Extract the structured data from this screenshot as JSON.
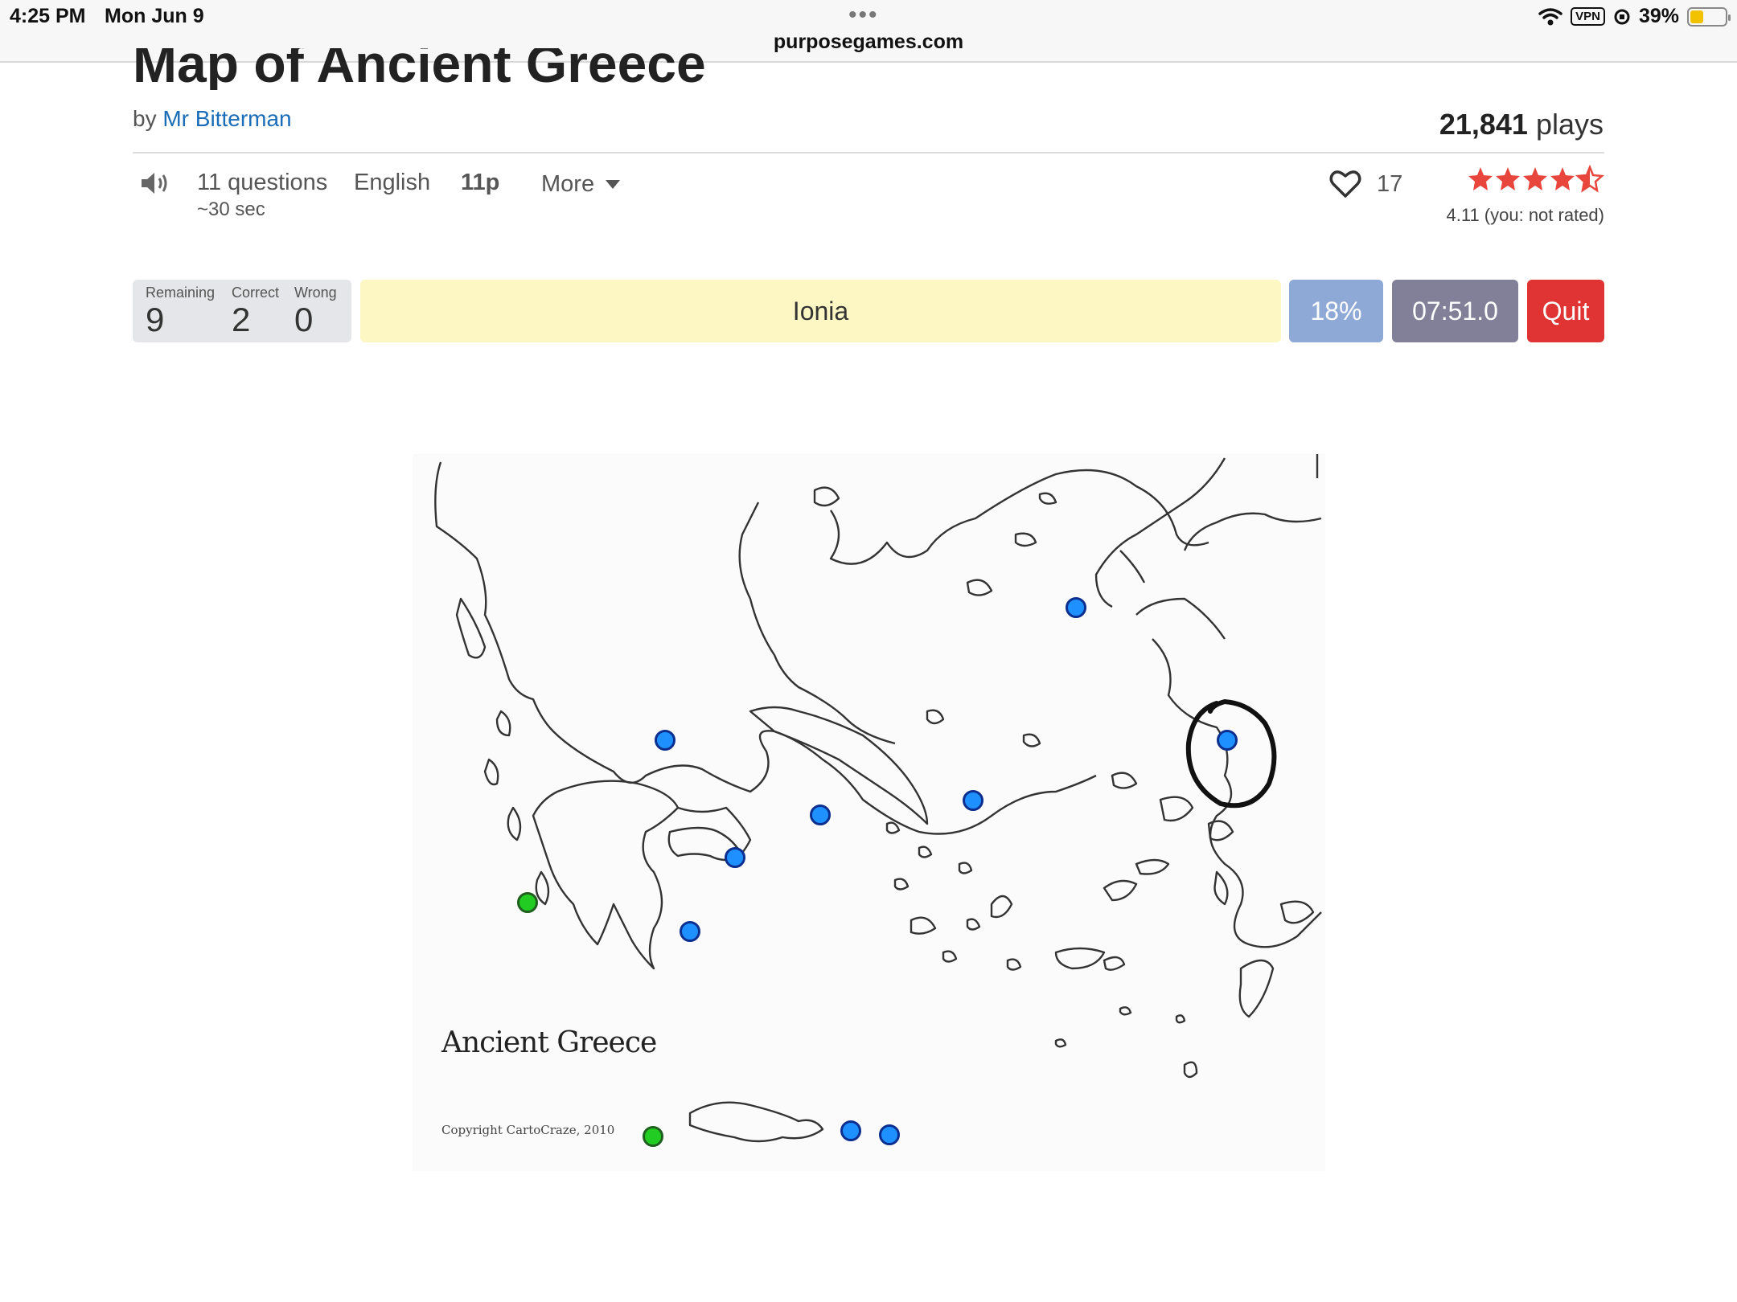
{
  "status_bar": {
    "time": "4:25 PM",
    "date": "Mon Jun 9",
    "url": "purposegames.com",
    "vpn": "VPN",
    "battery": "39%"
  },
  "header": {
    "title": "Map of Ancient Greece",
    "by": "by",
    "author": "Mr Bitterman",
    "plays_count": "21,841",
    "plays_label": "plays"
  },
  "meta": {
    "questions": "11 questions",
    "duration": "~30 sec",
    "language": "English",
    "points": "11p",
    "more": "More",
    "likes": "17",
    "rating_text": "4.11 (you: not rated)",
    "rating_value": 4.11
  },
  "quiz": {
    "remaining_label": "Remaining",
    "remaining": "9",
    "correct_label": "Correct",
    "correct": "2",
    "wrong_label": "Wrong",
    "wrong": "0",
    "prompt": "Ionia",
    "progress": "18%",
    "timer": "07:51.0",
    "quit": "Quit"
  },
  "map": {
    "title": "Ancient Greece",
    "copyright": "Copyright CartoCraze, 2010"
  },
  "colors": {
    "prompt_bg": "#fdf7c4",
    "progress_bg": "#8fa9d6",
    "timer_bg": "#828099",
    "quit_bg": "#e03434",
    "star": "#e8453c",
    "dot_blue": "#1e90ff",
    "dot_green": "#22cc22"
  }
}
